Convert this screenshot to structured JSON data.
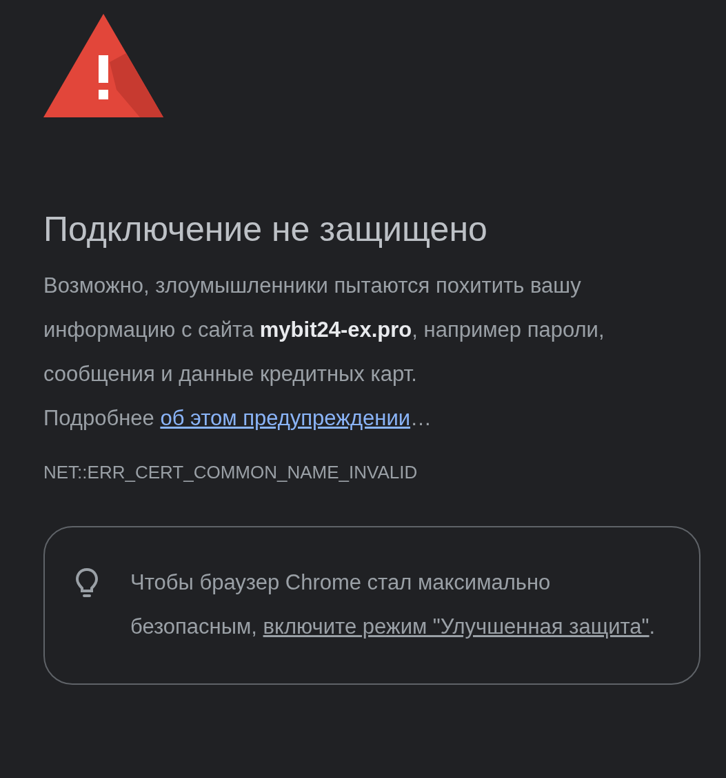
{
  "title": "Подключение не защищено",
  "description": "Возможно, злоумышленники пытаются похитить вашу информацию с сайта **mybit24-ex.pro**, например пароли, сообщения и данные кредитных карт.",
  "learn_more": {
    "prefix": "Подробнее ",
    "link": "об этом предупреждении",
    "suffix": "…"
  },
  "error_code": "NET::ERR_CERT_COMMON_NAME_INVALID",
  "tip": {
    "prefix": "Чтобы браузер Chrome стал максимально безопасным, ",
    "link": "включите режим \"Улучшенная защита\"",
    "suffix": "."
  }
}
